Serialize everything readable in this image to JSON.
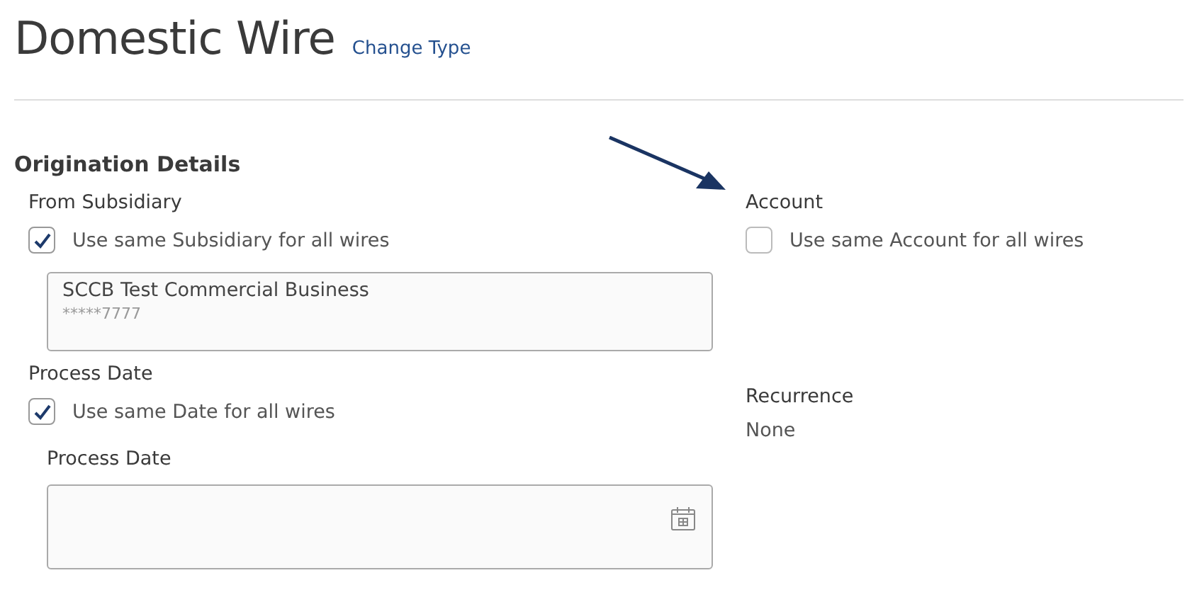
{
  "header": {
    "title": "Domestic Wire",
    "link": "Change Type"
  },
  "section": {
    "title": "Origination Details"
  },
  "left": {
    "subsidiary": {
      "label": "From Subsidiary",
      "checkbox": {
        "label": "Use same Subsidiary for all wires",
        "checked": true
      },
      "field": {
        "value": "SCCB Test Commercial Business",
        "subvalue": "*****7777"
      }
    },
    "process_date": {
      "label": "Process Date",
      "checkbox": {
        "label": "Use same Date for all wires",
        "checked": true
      },
      "field_label": "Process Date"
    }
  },
  "right": {
    "account": {
      "label": "Account",
      "checkbox": {
        "label": "Use same Account for all wires",
        "checked": false
      }
    },
    "recurrence": {
      "label": "Recurrence",
      "value": "None"
    }
  }
}
